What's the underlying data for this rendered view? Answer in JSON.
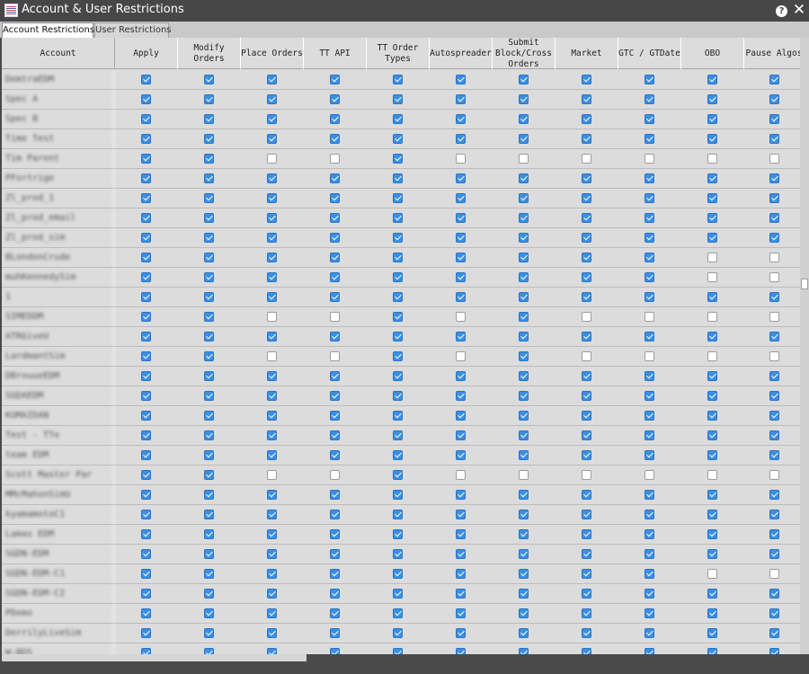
{
  "window": {
    "title": "Account & User Restrictions",
    "help_label": "?",
    "close_label": "✕"
  },
  "tabs": [
    {
      "label": "Account Restrictions",
      "active": true
    },
    {
      "label": "User Restrictions",
      "active": false
    }
  ],
  "colors": {
    "checkbox_checked": "#3b8fe3",
    "grid_background": "#dcdcdc",
    "titlebar": "#474747"
  },
  "columns": [
    "Account",
    "Apply",
    "Modify\nOrders",
    "Place Orders",
    "TT API",
    "TT Order\nTypes",
    "Autospreader",
    "Submit\nBlock/Cross\nOrders",
    "Market",
    "GTC / GTDate",
    "OBO",
    "Pause Algos"
  ],
  "rows": [
    {
      "account": "DemtraEDM",
      "values": [
        1,
        1,
        1,
        1,
        1,
        1,
        1,
        1,
        1,
        1,
        1
      ]
    },
    {
      "account": "Spec A",
      "values": [
        1,
        1,
        1,
        1,
        1,
        1,
        1,
        1,
        1,
        1,
        1
      ]
    },
    {
      "account": "Spec B",
      "values": [
        1,
        1,
        1,
        1,
        1,
        1,
        1,
        1,
        1,
        1,
        1
      ]
    },
    {
      "account": "Time Test",
      "values": [
        1,
        1,
        1,
        1,
        1,
        1,
        1,
        1,
        1,
        1,
        1
      ]
    },
    {
      "account": "Tim Parent",
      "values": [
        1,
        1,
        0,
        0,
        1,
        0,
        0,
        0,
        0,
        0,
        0
      ]
    },
    {
      "account": "PFortrige",
      "values": [
        1,
        1,
        1,
        1,
        1,
        1,
        1,
        1,
        1,
        1,
        1
      ]
    },
    {
      "account": "Zl_prod_1",
      "values": [
        1,
        1,
        1,
        1,
        1,
        1,
        1,
        1,
        1,
        1,
        1
      ]
    },
    {
      "account": "Zl_prod_email",
      "values": [
        1,
        1,
        1,
        1,
        1,
        1,
        1,
        1,
        1,
        1,
        1
      ]
    },
    {
      "account": "Zl_prod_sim",
      "values": [
        1,
        1,
        1,
        1,
        1,
        1,
        1,
        1,
        1,
        1,
        1
      ]
    },
    {
      "account": "BLondonCrude",
      "values": [
        1,
        1,
        1,
        1,
        1,
        1,
        1,
        1,
        1,
        0,
        0
      ]
    },
    {
      "account": "muhKennedySim",
      "values": [
        1,
        1,
        1,
        1,
        1,
        1,
        1,
        1,
        1,
        0,
        0
      ]
    },
    {
      "account": "1",
      "values": [
        1,
        1,
        1,
        1,
        1,
        1,
        1,
        1,
        1,
        1,
        1
      ]
    },
    {
      "account": "SIMEDDM",
      "values": [
        1,
        1,
        0,
        0,
        1,
        0,
        1,
        0,
        0,
        0,
        0
      ]
    },
    {
      "account": "ATRGiveU",
      "values": [
        1,
        1,
        1,
        1,
        1,
        1,
        1,
        1,
        1,
        1,
        1
      ]
    },
    {
      "account": "LardmantSim",
      "values": [
        1,
        1,
        0,
        0,
        1,
        0,
        1,
        0,
        0,
        0,
        0
      ]
    },
    {
      "account": "DBrouueEDM",
      "values": [
        1,
        1,
        1,
        1,
        1,
        1,
        1,
        1,
        1,
        1,
        1
      ]
    },
    {
      "account": "SGDAEDM",
      "values": [
        1,
        1,
        1,
        1,
        1,
        1,
        1,
        1,
        1,
        1,
        1
      ]
    },
    {
      "account": "KUMAIDAN",
      "values": [
        1,
        1,
        1,
        1,
        1,
        1,
        1,
        1,
        1,
        1,
        1
      ]
    },
    {
      "account": "Test - TTe",
      "values": [
        1,
        1,
        1,
        1,
        1,
        1,
        1,
        1,
        1,
        1,
        1
      ]
    },
    {
      "account": "team EDM",
      "values": [
        1,
        1,
        1,
        1,
        1,
        1,
        1,
        1,
        1,
        1,
        1
      ]
    },
    {
      "account": "Scott Master Par",
      "values": [
        1,
        1,
        0,
        0,
        1,
        0,
        0,
        0,
        0,
        0,
        0
      ]
    },
    {
      "account": "MMcMahonSimU",
      "values": [
        1,
        1,
        1,
        1,
        1,
        1,
        1,
        1,
        1,
        1,
        1
      ]
    },
    {
      "account": "kyamamotoC1",
      "values": [
        1,
        1,
        1,
        1,
        1,
        1,
        1,
        1,
        1,
        1,
        1
      ]
    },
    {
      "account": "Lamas EDM",
      "values": [
        1,
        1,
        1,
        1,
        1,
        1,
        1,
        1,
        1,
        1,
        1
      ]
    },
    {
      "account": "SGDN-EDM",
      "values": [
        1,
        1,
        1,
        1,
        1,
        1,
        1,
        1,
        1,
        1,
        1
      ]
    },
    {
      "account": "SGDN-EDM-C1",
      "values": [
        1,
        1,
        1,
        1,
        1,
        1,
        1,
        1,
        1,
        0,
        0
      ]
    },
    {
      "account": "SGDN-EDM-C2",
      "values": [
        1,
        1,
        1,
        1,
        1,
        1,
        1,
        1,
        1,
        1,
        1
      ]
    },
    {
      "account": "PDemo",
      "values": [
        1,
        1,
        1,
        1,
        1,
        1,
        1,
        1,
        1,
        1,
        1
      ]
    },
    {
      "account": "DerrilyLiveSim",
      "values": [
        1,
        1,
        1,
        1,
        1,
        1,
        1,
        1,
        1,
        1,
        1
      ]
    },
    {
      "account": "W-BDS",
      "values": [
        1,
        1,
        1,
        1,
        1,
        1,
        1,
        1,
        1,
        1,
        1
      ]
    }
  ]
}
